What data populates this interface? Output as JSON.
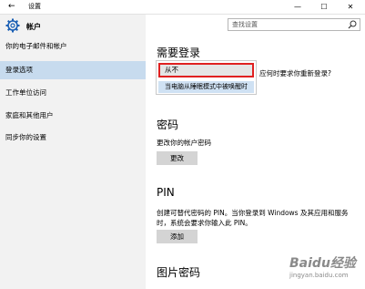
{
  "window": {
    "title": "设置",
    "minimize": "—",
    "maximize": "☐",
    "close": "✕",
    "back": "←"
  },
  "sidebar": {
    "header": "帐户",
    "items": [
      {
        "label": "你的电子邮件和帐户",
        "active": false
      },
      {
        "label": "登录选项",
        "active": true
      },
      {
        "label": "工作单位访问",
        "active": false
      },
      {
        "label": "家庭和其他用户",
        "active": false
      },
      {
        "label": "同步你的设置",
        "active": false
      }
    ]
  },
  "search": {
    "placeholder": "查找设置"
  },
  "main": {
    "require_login": {
      "title": "需要登录",
      "dropdown_selected": "从不",
      "dropdown_option": "当电脑从睡眠模式中被唤醒时",
      "question": "应何时要求你重新登录?"
    },
    "password": {
      "title": "密码",
      "desc": "更改你的帐户密码",
      "button": "更改"
    },
    "pin": {
      "title": "PIN",
      "desc_line1": "创建可替代密码的 PIN。当你登录到 Windows 及其应用和服务",
      "desc_line2": "时，系统会要求你输入此 PIN。",
      "button": "添加"
    },
    "picture_password": {
      "title": "图片密码"
    }
  },
  "watermark": {
    "logo": "Baidu经验",
    "url": "jingyan.baidu.com"
  },
  "colors": {
    "sidebar_bg": "#f2f2f2",
    "active_bg": "#c7dbee",
    "highlight_border": "#e02020",
    "button_bg": "#d4d4d4"
  }
}
